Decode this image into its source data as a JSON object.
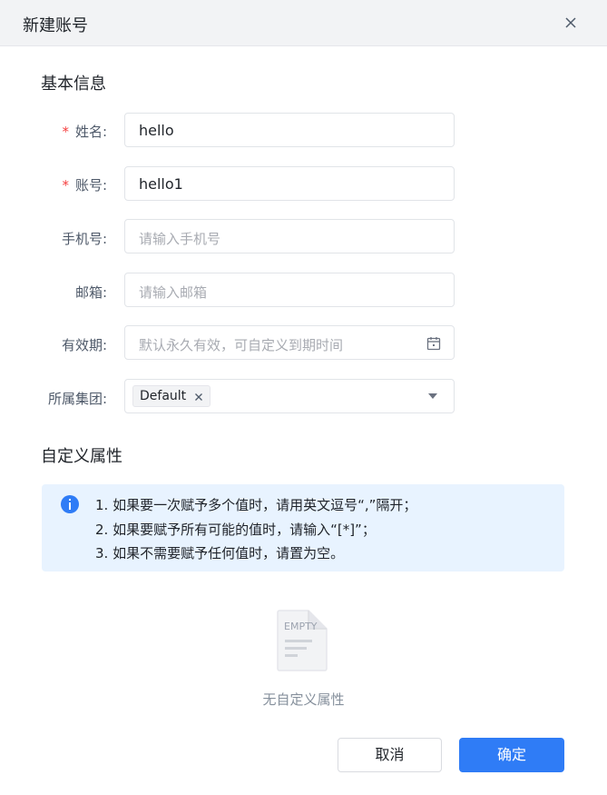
{
  "dialog": {
    "title": "新建账号",
    "close_icon": "close-icon"
  },
  "basic_info": {
    "title": "基本信息",
    "fields": {
      "name": {
        "label": "姓名:",
        "required": "*",
        "value": "hello"
      },
      "account": {
        "label": "账号:",
        "required": "*",
        "value": "hello1"
      },
      "phone": {
        "label": "手机号:",
        "placeholder": "请输入手机号"
      },
      "email": {
        "label": "邮箱:",
        "placeholder": "请输入邮箱"
      },
      "validity": {
        "label": "有效期:",
        "placeholder": "默认永久有效，可自定义到期时间",
        "icon": "calendar-icon"
      },
      "group": {
        "label": "所属集团:",
        "tag": "Default"
      }
    }
  },
  "custom_attrs": {
    "title": "自定义属性",
    "info_lines": [
      "1. 如果要一次赋予多个值时，请用英文逗号“,”隔开；",
      "2. 如果要赋予所有可能的值时，请输入“[*]”；",
      "3. 如果不需要赋予任何值时，请置为空。"
    ],
    "empty_label": "EMPTY",
    "empty_text": "无自定义属性"
  },
  "footer": {
    "cancel_label": "取消",
    "ok_label": "确定"
  },
  "colors": {
    "primary": "#2f7cf6",
    "required": "#f53f3f",
    "info_bg": "#e8f3ff"
  }
}
